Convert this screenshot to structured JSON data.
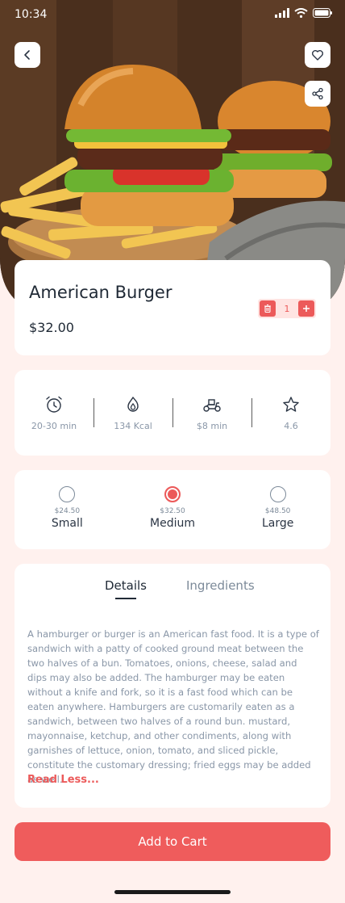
{
  "status_bar": {
    "time": "10:34"
  },
  "nav": {
    "back_icon": "chevron-left-icon",
    "favorite_icon": "heart-icon",
    "share_icon": "share-icon"
  },
  "product": {
    "title": "American Burger",
    "price": "$32.00",
    "quantity": "1"
  },
  "stats": [
    {
      "icon": "alarm-clock-icon",
      "label": "20-30 min"
    },
    {
      "icon": "flame-icon",
      "label": "134 Kcal"
    },
    {
      "icon": "delivery-scooter-icon",
      "label": "$8 min"
    },
    {
      "icon": "star-icon",
      "label": "4.6"
    }
  ],
  "sizes": [
    {
      "name": "Small",
      "price": "$24.50",
      "selected": false
    },
    {
      "name": "Medium",
      "price": "$32.50",
      "selected": true
    },
    {
      "name": "Large",
      "price": "$48.50",
      "selected": false
    }
  ],
  "tabs": {
    "details": "Details",
    "ingredients": "Ingredients",
    "active": "details"
  },
  "description": "A hamburger or burger is an American fast food. It is a type of sandwich with a patty of cooked ground meat between the two halves of a bun. Tomatoes, onions, cheese, salad and dips may also be added. The hamburger may be eaten without a knife and fork, so it is a fast food which can be eaten anywhere. Hamburgers are customarily eaten as a sandwich, between two halves of a round bun. mustard, mayonnaise, ketchup, and other condiments, along with garnishes of lettuce, onion, tomato, and sliced pickle, constitute the customary dressing; fried eggs may be added as well.",
  "read_less": "Read Less...",
  "cart_button": "Add to Cart",
  "colors": {
    "accent": "#ef5c5c",
    "background": "#fff1ee",
    "text": "#2b3544",
    "muted": "#8a97a8"
  }
}
